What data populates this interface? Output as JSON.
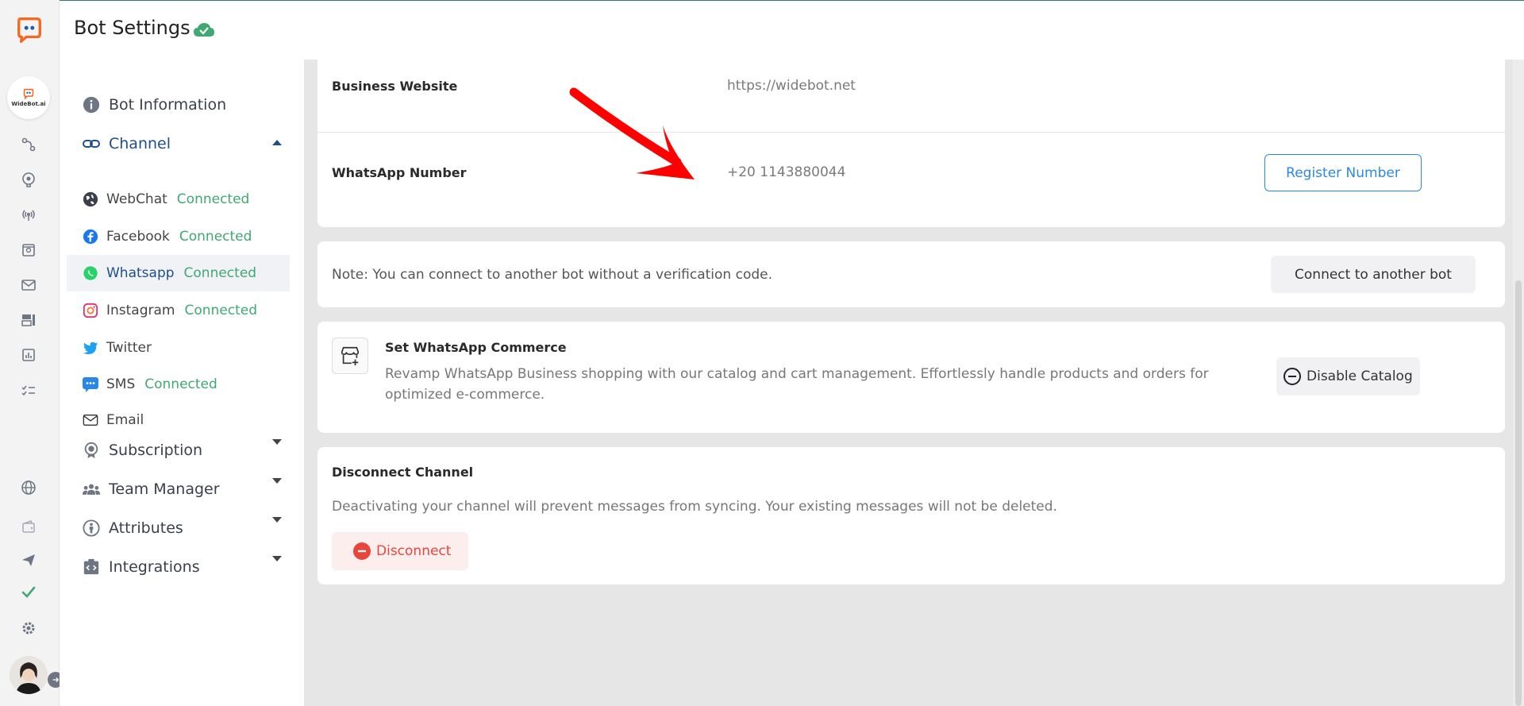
{
  "header": {
    "title": "Bot Settings"
  },
  "rail": {
    "bot_name": "WideBot.ai",
    "icons": [
      "flow-icon",
      "brain-icon",
      "broadcast-icon",
      "inbox-icon",
      "mail-icon",
      "dashboard-icon",
      "analytics-icon",
      "tasks-icon",
      "globe-icon",
      "wallet-icon",
      "send-icon",
      "check-icon",
      "gear-icon"
    ]
  },
  "sidebar": {
    "bot_information": "Bot Information",
    "channel": "Channel",
    "channels": [
      {
        "label": "WebChat",
        "status": "Connected"
      },
      {
        "label": "Facebook",
        "status": "Connected"
      },
      {
        "label": "Whatsapp",
        "status": "Connected"
      },
      {
        "label": "Instagram",
        "status": "Connected"
      },
      {
        "label": "Twitter",
        "status": ""
      },
      {
        "label": "SMS",
        "status": "Connected"
      },
      {
        "label": "Email",
        "status": ""
      }
    ],
    "subscription": "Subscription",
    "team_manager": "Team Manager",
    "attributes": "Attributes",
    "integrations": "Integrations"
  },
  "main": {
    "business_website_label": "Business Website",
    "business_website_value": "https://widebot.net",
    "whatsapp_number_label": "WhatsApp Number",
    "whatsapp_number_value": "+20 1143880044",
    "register_button": "Register Number",
    "note_text": "Note: You can connect to another bot without a verification code.",
    "connect_button": "Connect to another bot",
    "commerce_title": "Set WhatsApp Commerce",
    "commerce_desc_line1": "Revamp WhatsApp Business shopping with our catalog and cart management. Effortlessly handle products and orders for",
    "commerce_desc_line2": "optimized e-commerce.",
    "disable_catalog_button": "Disable Catalog",
    "disconnect_title": "Disconnect Channel",
    "disconnect_desc": "Deactivating your channel will prevent messages from syncing. Your existing messages will not be deleted.",
    "disconnect_button": "Disconnect"
  },
  "colors": {
    "accent_blue": "#2b87e6",
    "connected_green": "#3fa873",
    "danger_red": "#e8463a",
    "arrow_red": "#ff0000"
  }
}
